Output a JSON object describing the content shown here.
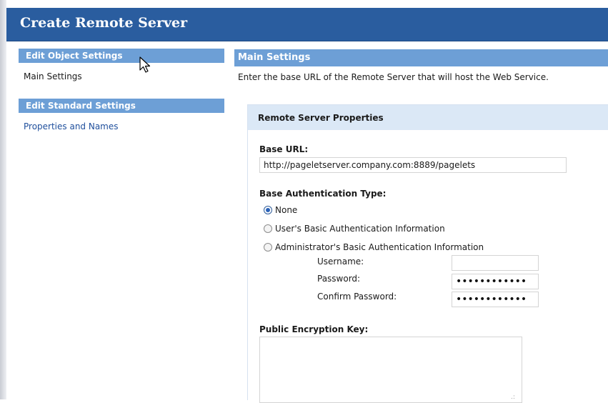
{
  "window": {
    "title": "Create Remote Server"
  },
  "sidebar": {
    "sections": [
      {
        "header": "Edit Object Settings",
        "items": [
          {
            "label": "Main Settings",
            "is_link": false
          }
        ]
      },
      {
        "header": "Edit Standard Settings",
        "items": [
          {
            "label": "Properties and Names",
            "is_link": true
          }
        ]
      }
    ]
  },
  "main": {
    "header": "Main Settings",
    "intro": "Enter the base URL of the Remote Server that will host the Web Service.",
    "properties": {
      "title": "Remote Server Properties",
      "base_url": {
        "label": "Base URL:",
        "value": "http://pageletserver.company.com:8889/pagelets"
      },
      "auth": {
        "label": "Base Authentication Type:",
        "options": [
          {
            "label": "None",
            "selected": true
          },
          {
            "label": "User's Basic Authentication Information",
            "selected": false
          },
          {
            "label": "Administrator's Basic Authentication Information",
            "selected": false
          }
        ],
        "username": {
          "label": "Username:",
          "value": ""
        },
        "password": {
          "label": "Password:",
          "value": "••••••••••••"
        },
        "confirm_password": {
          "label": "Confirm Password:",
          "value": "••••••••••••"
        }
      },
      "encryption_key": {
        "label": "Public Encryption Key:",
        "value": ""
      }
    }
  },
  "colors": {
    "title_bar": "#2a5d9f",
    "section_header": "#6d9fd6",
    "props_header": "#dbe8f6",
    "link": "#1f4f9c"
  },
  "icons": {
    "cursor": "mouse-pointer-icon",
    "resize_grip": "resize-grip-icon"
  }
}
